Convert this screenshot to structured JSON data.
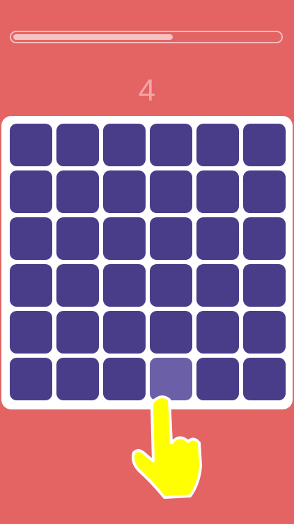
{
  "game": {
    "score": "4",
    "timer_progress": 0.6
  },
  "colors": {
    "background": "#e46464",
    "board": "#ffffff",
    "tile": "#493d8a",
    "tile_odd": "#6b5fa7",
    "hand": "#ffff00"
  },
  "grid": {
    "rows": 6,
    "cols": 6,
    "odd_tile": {
      "row": 6,
      "col": 4
    }
  },
  "hint": {
    "icon": "pointing-hand-icon"
  }
}
